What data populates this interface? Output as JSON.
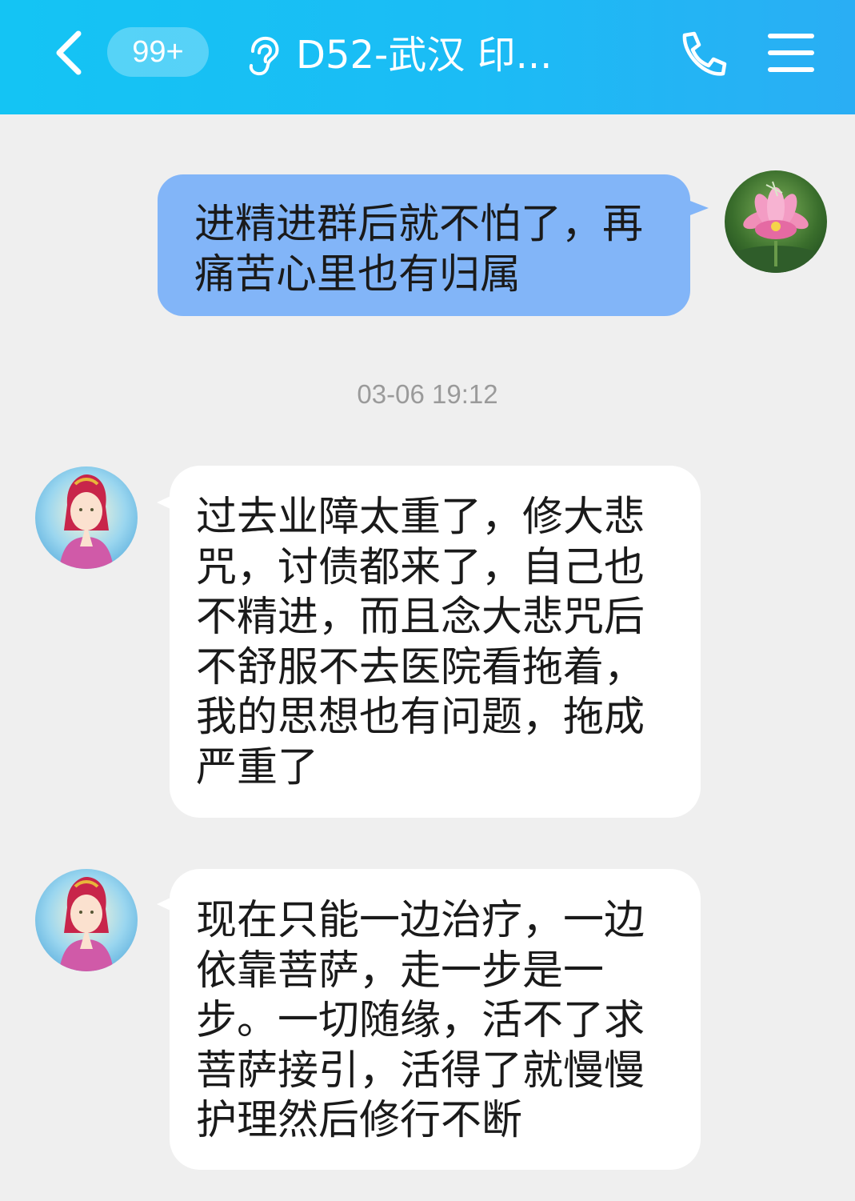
{
  "header": {
    "badge": "99+",
    "title": "D52-武汉 印..."
  },
  "messages": [
    {
      "direction": "outgoing",
      "text": "进精进群后就不怕了，再\n痛苦心里也有归属"
    },
    {
      "direction": "incoming",
      "text": "过去业障太重了，修大悲\n咒，讨债都来了，自己也\n不精进，而且念大悲咒后\n不舒服不去医院看拖着，\n我的思想也有问题，拖成\n严重了"
    },
    {
      "direction": "incoming",
      "text": "现在只能一边治疗，一边\n依靠菩萨，走一步是一\n步。一切随缘，活不了求\n菩萨接引，活得了就慢慢\n护理然后修行不断"
    }
  ],
  "timestamp": "03-06 19:12",
  "colors": {
    "header": "#1bbcf5",
    "outgoing_bubble": "#82b5f8",
    "incoming_bubble": "#ffffff",
    "background": "#efefef"
  },
  "icons": [
    "back-icon",
    "ear-icon",
    "phone-icon",
    "menu-icon"
  ]
}
